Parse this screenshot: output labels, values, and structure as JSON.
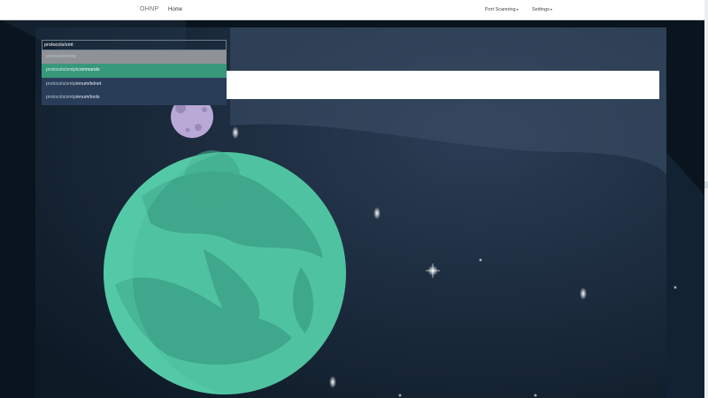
{
  "navbar": {
    "brand": "OHNP",
    "home": "Home",
    "port_scanning": "Port Scanning",
    "settings": "Settings",
    "caret": "▾"
  },
  "search": {
    "value": "protocols/smt",
    "suggestions": [
      {
        "match": "protocols/smtp",
        "rest": ""
      },
      {
        "match": "protocols/smtp",
        "rest": "/commands"
      },
      {
        "match": "protocols/smtp",
        "rest": "/enum/telnet"
      },
      {
        "match": "protocols/smtp",
        "rest": "/enum/tools"
      }
    ]
  },
  "page": {
    "title": "Port Scanning"
  },
  "colors": {
    "accent": "#38987a",
    "planet": "#4fc3a1",
    "background": "#1b2a3d"
  }
}
